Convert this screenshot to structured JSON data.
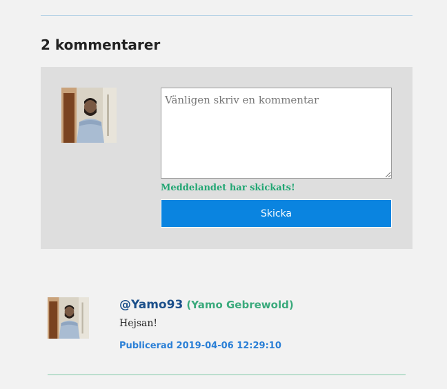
{
  "comments": {
    "heading": "2 kommentarer",
    "compose": {
      "placeholder": "Vänligen skriv en kommentar",
      "status_message": "Meddelandet har skickats!",
      "submit_label": "Skicka"
    },
    "items": [
      {
        "username": "@Yamo93",
        "full_name": "(Yamo Gebrewold)",
        "body": "Hejsan!",
        "published": "Publicerad 2019-04-06 12:29:10"
      }
    ]
  },
  "colors": {
    "accent": "#0a84e0",
    "success": "#21a673",
    "username": "#1b4f8a"
  }
}
